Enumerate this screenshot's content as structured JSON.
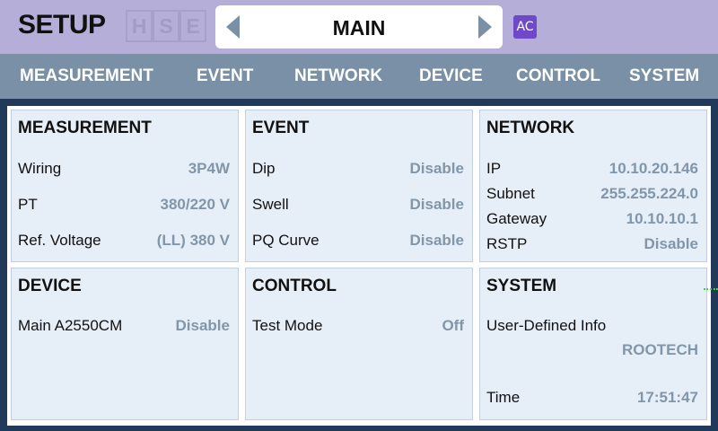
{
  "header": {
    "title": "SETUP",
    "hse": [
      "H",
      "S",
      "E"
    ],
    "page_name": "MAIN",
    "badge": "AC"
  },
  "tabs": [
    {
      "label": "MEASUREMENT"
    },
    {
      "label": "EVENT"
    },
    {
      "label": "NETWORK"
    },
    {
      "label": "DEVICE"
    },
    {
      "label": "CONTROL"
    },
    {
      "label": "SYSTEM"
    }
  ],
  "panels": {
    "measurement": {
      "title": "MEASUREMENT",
      "rows": [
        {
          "label": "Wiring",
          "value": "3P4W"
        },
        {
          "label": "PT",
          "value": "380/220 V"
        },
        {
          "label": "Ref. Voltage",
          "value": "(LL) 380 V"
        }
      ]
    },
    "event": {
      "title": "EVENT",
      "rows": [
        {
          "label": "Dip",
          "value": "Disable"
        },
        {
          "label": "Swell",
          "value": "Disable"
        },
        {
          "label": "PQ Curve",
          "value": "Disable"
        }
      ]
    },
    "network": {
      "title": "NETWORK",
      "rows": [
        {
          "label": "IP",
          "value": "10.10.20.146"
        },
        {
          "label": "Subnet",
          "value": "255.255.224.0"
        },
        {
          "label": "Gateway",
          "value": "10.10.10.1"
        },
        {
          "label": "RSTP",
          "value": "Disable"
        }
      ]
    },
    "device": {
      "title": "DEVICE",
      "rows": [
        {
          "label": "Main A2550CM",
          "value": "Disable"
        }
      ]
    },
    "control": {
      "title": "CONTROL",
      "rows": [
        {
          "label": "Test Mode",
          "value": "Off"
        }
      ]
    },
    "system": {
      "title": "SYSTEM",
      "user_info_label": "User-Defined Info",
      "user_info_value": "ROOTECH",
      "time_label": "Time",
      "time_value": "17:51:47"
    }
  },
  "colors": {
    "header_bg": "#b5aed8",
    "tab_bar_bg": "#7a90a6",
    "panel_bg": "#e6eef8",
    "value_text": "#8296aa",
    "badge_bg": "#6f49c7",
    "arrow": "#7a90a6",
    "frame": "#223a5a"
  }
}
